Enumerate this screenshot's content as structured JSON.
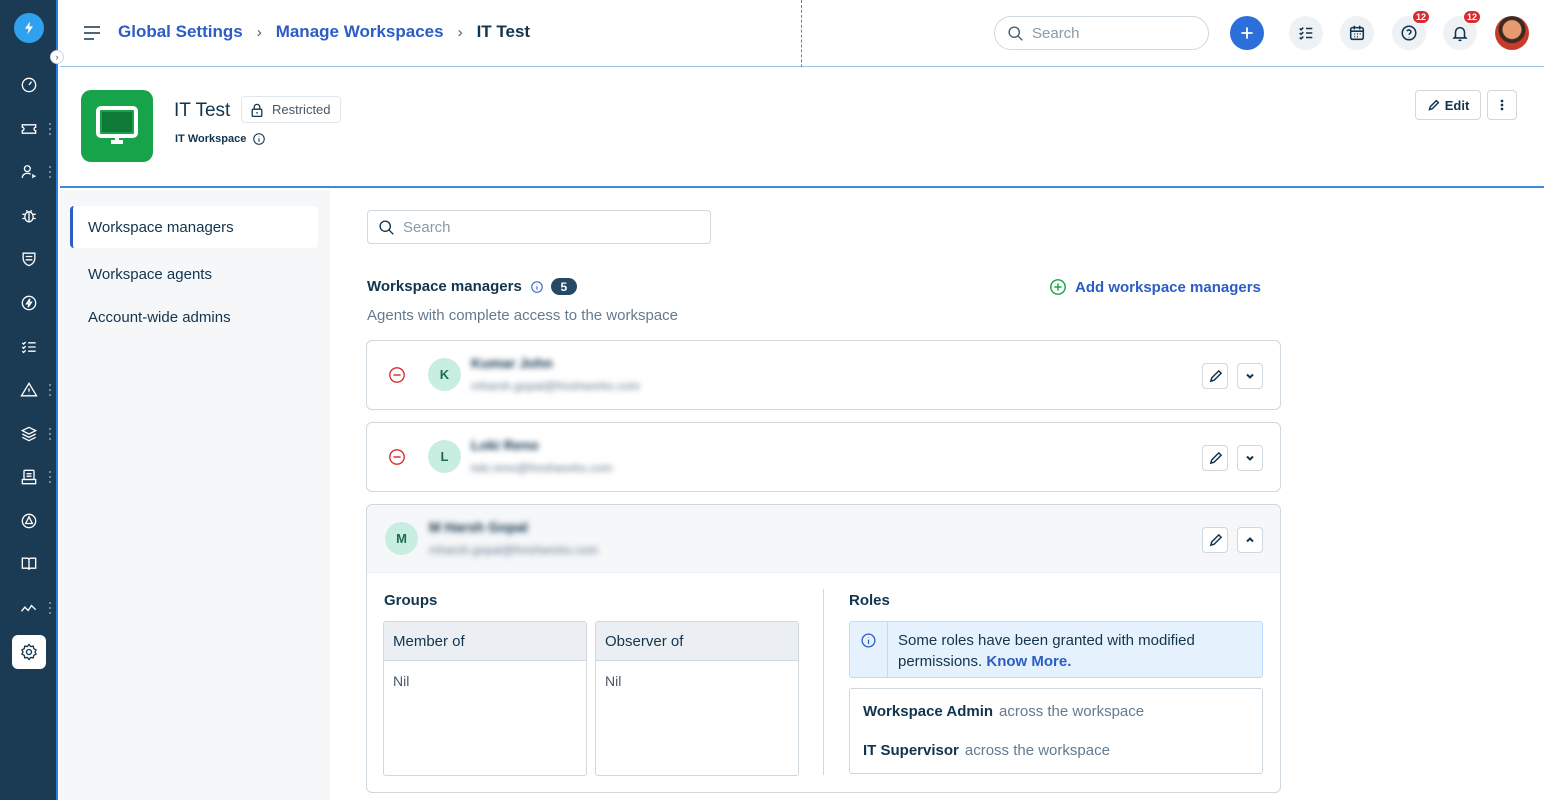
{
  "breadcrumb": {
    "items": [
      "Global Settings",
      "Manage Workspaces"
    ],
    "current": "IT Test"
  },
  "topbar": {
    "search_placeholder": "Search",
    "help_badge": "12",
    "notifications_badge": "12"
  },
  "workspace": {
    "title": "IT Test",
    "visibility": "Restricted",
    "subtitle": "IT Workspace",
    "edit_label": "Edit"
  },
  "sidenav": {
    "items": [
      "Workspace managers",
      "Workspace agents",
      "Account-wide admins"
    ]
  },
  "content": {
    "search_placeholder": "Search",
    "section_title": "Workspace managers",
    "count": "5",
    "description": "Agents with complete access to the workspace",
    "add_label": "Add workspace managers"
  },
  "managers": [
    {
      "initial": "K",
      "name": "Kumar John",
      "email": "mharsh.gopal@freshworks.com"
    },
    {
      "initial": "L",
      "name": "Loki Reno",
      "email": "loki.reno@freshworks.com"
    },
    {
      "initial": "M",
      "name": "M Harsh Gopal",
      "email": "mharsh.gopal@freshworks.com"
    }
  ],
  "expanded": {
    "groups_title": "Groups",
    "member_of_label": "Member of",
    "member_of_value": "Nil",
    "observer_of_label": "Observer of",
    "observer_of_value": "Nil",
    "roles_title": "Roles",
    "banner_text": "Some roles have been granted with modified permissions.",
    "banner_link": "Know More.",
    "roles": [
      {
        "name": "Workspace Admin",
        "scope": "across the workspace"
      },
      {
        "name": "IT Supervisor",
        "scope": "across the workspace"
      }
    ]
  },
  "colors": {
    "rail": "#1b3b55",
    "accent": "#2c5cc5",
    "brand_green": "#16a34a",
    "badge_red": "#d72d30"
  },
  "icons": {
    "rail": [
      "dashboard-icon",
      "tickets-icon",
      "contacts-icon",
      "problems-icon",
      "changes-icon",
      "releases-icon",
      "tasks-icon",
      "alerts-icon",
      "assets-icon",
      "projects-icon",
      "admin-icon",
      "solutions-icon",
      "analytics-icon",
      "settings-icon"
    ]
  }
}
